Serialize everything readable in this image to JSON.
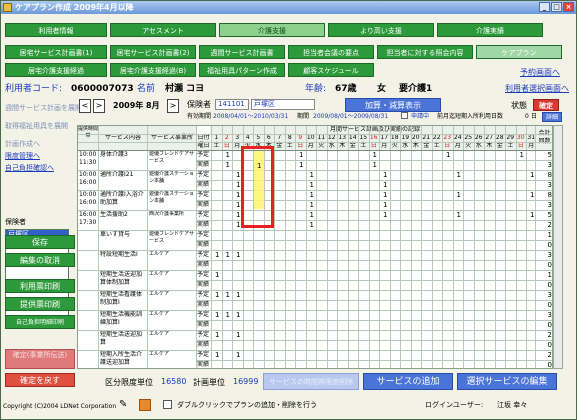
{
  "window": {
    "title": "ケアプラン作成 2009年4月以降",
    "buttons": [
      "_",
      "□",
      "×"
    ]
  },
  "nav_row1": [
    "利用者情報",
    "アセスメント",
    "介護支援",
    "より高い支援",
    "介護実績"
  ],
  "nav_row2": [
    "居宅サービス計画書(1)",
    "居宅サービス計画書(2)",
    "週間サービス計画書",
    "担当者会議の要点",
    "担当者に対する照会内容",
    "ケアプラン"
  ],
  "nav_row3": [
    "居宅介護支援経過",
    "居宅介護支援経過(B)",
    "福祉用具パターン作成",
    "顧客スケジュール"
  ],
  "nav_link": "予約画面へ",
  "info": {
    "user_code_label": "利用者コード:",
    "user_code": "0600007073",
    "name_label": "名前",
    "name": "村瀬 コヨ",
    "age_label": "年齢:",
    "age": "67歳",
    "sex": "女",
    "care_level": "要介護1",
    "select_link": "利用者選択画面へ"
  },
  "sidebar": {
    "links": [
      {
        "label": "週間サービス計画を展開",
        "on": false
      },
      {
        "label": "取得福祉用具を展開",
        "on": false
      },
      {
        "label": "計画作成へ",
        "on": false
      },
      {
        "label": "限度管理へ",
        "on": true
      },
      {
        "label": "自己負担確認へ",
        "on": true
      }
    ],
    "insurer_label": "保険者",
    "insurer_selected": "戸塚区",
    "buttons": [
      "保存",
      "編集の取消",
      "利用票印刷",
      "提供票印刷",
      "自己負担明細印刷",
      "確定(事業所伝送)",
      "確定を戻す"
    ]
  },
  "controls": {
    "prev": "<",
    "next": ">",
    "month": "2009年 8月",
    "today_arrow": ">",
    "insurer_no_label": "保険者",
    "insurer_no": "141101",
    "insurer_name": "戸塚区",
    "add_button": "加算・減算表示",
    "status_label": "状態",
    "status_button": "確定",
    "validity_label": "有効期間",
    "validity": "2008/04/01〜2010/03/31",
    "period_label": "期間",
    "period": "2009/08/01〜2009/08/31",
    "applying": "申請中",
    "prev_month_label": "前月迄短期入所利用日数",
    "prev_month_days": "0",
    "prev_month_unit": "日",
    "detail_button": "詳細"
  },
  "grid": {
    "title": "月間サービス計画及び実績の記録",
    "col_time": "提供時間帯",
    "col_service": "サービス内容",
    "col_office": "サービス事業所",
    "label_day": "日付",
    "label_weekday": "曜日",
    "total_label": "合計回数",
    "days": [
      "1",
      "2",
      "3",
      "4",
      "5",
      "6",
      "7",
      "8",
      "9",
      "10",
      "11",
      "12",
      "13",
      "14",
      "15",
      "16",
      "17",
      "18",
      "19",
      "20",
      "21",
      "22",
      "23",
      "24",
      "25",
      "26",
      "27",
      "28",
      "29",
      "30",
      "31"
    ],
    "weekdays": [
      "土",
      "日",
      "月",
      "火",
      "水",
      "木",
      "金",
      "土",
      "日",
      "月",
      "火",
      "水",
      "木",
      "金",
      "土",
      "日",
      "月",
      "火",
      "水",
      "木",
      "金",
      "土",
      "日",
      "月",
      "火",
      "水",
      "木",
      "金",
      "土",
      "日",
      "月"
    ],
    "rows": [
      {
        "time": "10:00\n11:30",
        "service": "身体介護3",
        "office": "遊優フレンドケアサービス",
        "plan": [
          2,
          9,
          16,
          23,
          30
        ],
        "actual": [
          2,
          9,
          16
        ],
        "total_plan": "5",
        "total_actual": "3"
      },
      {
        "time": "10:00\n16:00",
        "service": "通所介護I21",
        "office": "遊優介護ステーション本舗",
        "plan": [
          3,
          10,
          17,
          24,
          31
        ],
        "actual": [
          3,
          10,
          17
        ],
        "total_plan": "8",
        "total_actual": "3"
      },
      {
        "time": "10:00\n16:00",
        "service": "通所介護I入浴介助加算",
        "office": "遊優介護ステーション本舗",
        "plan": [
          3,
          10,
          17,
          24,
          31
        ],
        "actual": [
          3,
          10,
          17
        ],
        "total_plan": "8",
        "total_actual": "3"
      },
      {
        "time": "16:00\n17:30",
        "service": "生活援助2",
        "office": "西沢介護事業所",
        "plan": [
          3,
          10,
          17,
          24,
          31
        ],
        "actual": [
          3,
          10
        ],
        "total_plan": "5",
        "total_actual": "2"
      },
      {
        "time": "",
        "service": "車いす貸与",
        "office": "遊優フレンドケアサービス",
        "plan": [],
        "actual": [],
        "total_plan": "1",
        "total_actual": "0"
      },
      {
        "time": "",
        "service": "特設短期生活Ⅰ",
        "office": "エルケア",
        "plan": [
          1,
          2,
          3
        ],
        "actual": [],
        "total_plan": "3",
        "total_actual": "0"
      },
      {
        "time": "",
        "service": "短期生活送迎加算体制加算",
        "office": "エルケア",
        "plan": [
          1
        ],
        "actual": [],
        "total_plan": "1",
        "total_actual": "0"
      },
      {
        "time": "",
        "service": "短期生活看護体制加算Ⅰ",
        "office": "エルケア",
        "plan": [
          1,
          2,
          3
        ],
        "actual": [],
        "total_plan": "3",
        "total_actual": "0"
      },
      {
        "time": "",
        "service": "短期生活機能訓練加算Ⅰ",
        "office": "エルケア",
        "plan": [
          1,
          2,
          3
        ],
        "actual": [],
        "total_plan": "3",
        "total_actual": "0"
      },
      {
        "time": "",
        "service": "短期生活送迎加算",
        "office": "エルケア",
        "plan": [
          1,
          3
        ],
        "actual": [],
        "total_plan": "2",
        "total_actual": "0"
      },
      {
        "time": "",
        "service": "短期入所生活介護送迎加算",
        "office": "エルケア",
        "plan": [
          1,
          3
        ],
        "actual": [],
        "total_plan": "2",
        "total_actual": "0"
      }
    ]
  },
  "bottom": {
    "limit_label": "区分限度単位",
    "limit_value": "16580",
    "plan_label": "計画単位",
    "plan_value": "16999",
    "btn_temp_limit": "サービスの時間帯限度削除",
    "btn_add": "サービスの追加",
    "btn_edit": "選択サービスの編集"
  },
  "statusbar": {
    "copyright": "Copyright (C)2004 LDNet Corporation",
    "double_click_hint": "ダブルクリックでプランの追加・削除を行う",
    "login_label": "ログインユーザー:",
    "login_user": "江坂 幸々"
  },
  "colors": {
    "nav_green": "#2c9a3a",
    "blue_button": "#4a74d8",
    "red_button": "#d83a30",
    "highlight": "#fff36a",
    "annotation": "#e82020"
  }
}
